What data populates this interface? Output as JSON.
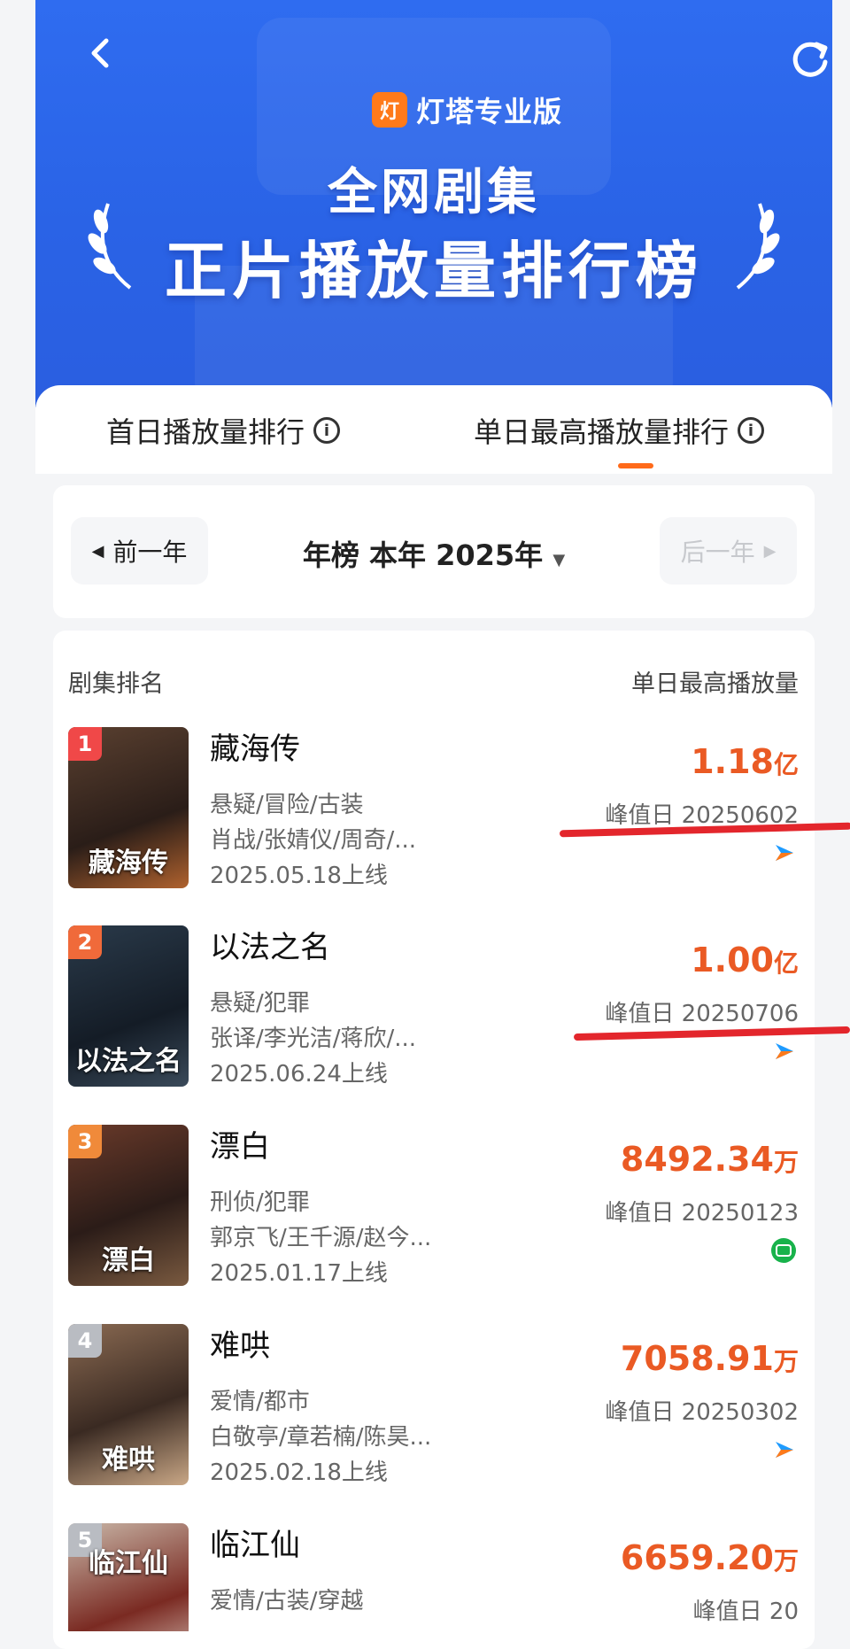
{
  "header": {
    "brand_logo_text": "灯",
    "brand_name": "灯塔专业版",
    "title_line1": "全网剧集",
    "title_line2": "正片播放量排行榜"
  },
  "tabs": [
    {
      "label": "首日播放量排行"
    },
    {
      "label": "单日最高播放量排行"
    }
  ],
  "year_nav": {
    "prev_label": "前一年",
    "current_label": "年榜 本年 2025年",
    "next_label": "后一年"
  },
  "list": {
    "col_left": "剧集排名",
    "col_right": "单日最高播放量",
    "items": [
      {
        "rank": "1",
        "poster_text": "藏海传",
        "name": "藏海传",
        "genre": "悬疑/冒险/古装",
        "cast": "肖战/张婧仪/周奇/...",
        "release": "2025.05.18上线",
        "value": "1.18",
        "unit": "亿",
        "peak": "峰值日 20250602",
        "platform_icon": "play-arrow-icon"
      },
      {
        "rank": "2",
        "poster_text": "以法之名",
        "name": "以法之名",
        "genre": "悬疑/犯罪",
        "cast": "张译/李光洁/蒋欣/...",
        "release": "2025.06.24上线",
        "value": "1.00",
        "unit": "亿",
        "peak": "峰值日 20250706",
        "platform_icon": "play-arrow-icon"
      },
      {
        "rank": "3",
        "poster_text": "漂白",
        "name": "漂白",
        "genre": "刑侦/犯罪",
        "cast": "郭京飞/王千源/赵今...",
        "release": "2025.01.17上线",
        "value": "8492.34",
        "unit": "万",
        "peak": "峰值日 20250123",
        "platform_icon": "iqiyi-icon"
      },
      {
        "rank": "4",
        "poster_text": "难哄",
        "name": "难哄",
        "genre": "爱情/都市",
        "cast": "白敬亭/章若楠/陈昊...",
        "release": "2025.02.18上线",
        "value": "7058.91",
        "unit": "万",
        "peak": "峰值日 20250302",
        "platform_icon": "play-arrow-icon"
      },
      {
        "rank": "5",
        "poster_text": "临江仙",
        "name": "临江仙",
        "genre": "爱情/古装/穿越",
        "cast": "",
        "release": "",
        "value": "6659.20",
        "unit": "万",
        "peak": "峰值日 20",
        "platform_icon": ""
      }
    ]
  },
  "colors": {
    "accent": "#ea5a24",
    "header_blue": "#2f6cf0",
    "annotation_red": "#e3262c"
  }
}
